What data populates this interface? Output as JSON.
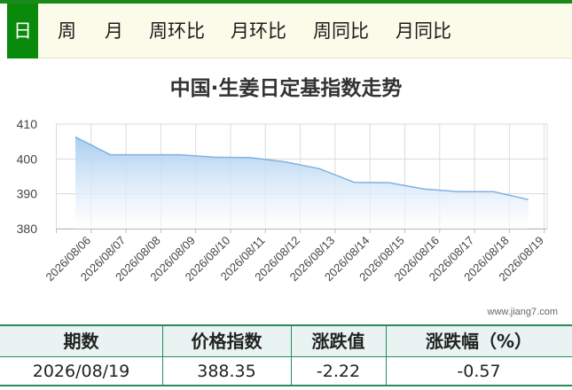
{
  "tabs": [
    "日",
    "周",
    "月",
    "周环比",
    "月环比",
    "周同比",
    "月同比"
  ],
  "colors": {
    "tab_active": "#0a8a0a",
    "line": "#7fb2e0",
    "fill_top": "#a9cdf0",
    "table_border": "#2a8a5a",
    "thead_bg": "#e8f3f2"
  },
  "chart_data": {
    "type": "area",
    "title": "中国·生姜日定基指数走势",
    "x": [
      "2026/08/06",
      "2026/08/07",
      "2026/08/08",
      "2026/08/09",
      "2026/08/10",
      "2026/08/11",
      "2026/08/12",
      "2026/08/13",
      "2026/08/14",
      "2026/08/15",
      "2026/08/16",
      "2026/08/17",
      "2026/08/18",
      "2026/08/19"
    ],
    "values": [
      406.3,
      401.2,
      401.2,
      401.2,
      400.5,
      400.4,
      399.2,
      397.2,
      393.3,
      393.2,
      391.4,
      390.6,
      390.6,
      388.35
    ],
    "yticks": [
      380,
      390,
      400,
      410
    ],
    "ylim": [
      380,
      410
    ],
    "grid": true
  },
  "watermark": "www.jiang7.com",
  "table": {
    "headers": [
      "期数",
      "价格指数",
      "涨跌值",
      "涨跌幅（%）"
    ],
    "row": [
      "2026/08/19",
      "388.35",
      "-2.22",
      "-0.57"
    ]
  }
}
